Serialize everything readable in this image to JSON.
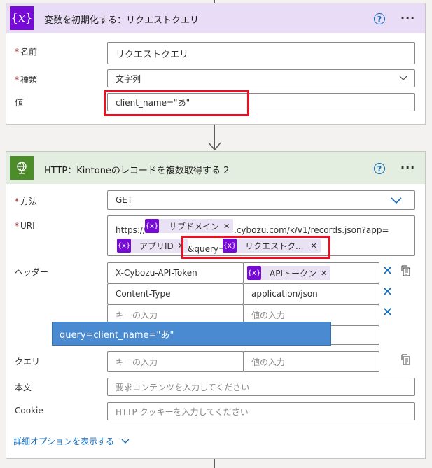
{
  "colors": {
    "var_header_bg": "#e8dcf6",
    "http_header_bg": "#e3eee0",
    "accent_purple": "#770bd6",
    "accent_green": "#4c8c2b",
    "link_blue": "#0f6cbd",
    "highlight_red": "#e81123",
    "tooltip_bg": "#4a8ad0"
  },
  "card1": {
    "title": "変数を初期化する：リクエストクエリ",
    "icon": "variable-icon",
    "icon_glyph": "{𝑥}",
    "help": "?",
    "menu": "···",
    "fields": {
      "name_label": "名前",
      "name_value": "リクエストクエリ",
      "type_label": "種類",
      "type_value": "文字列",
      "value_label": "値",
      "value_value": "client_name=\"あ\""
    }
  },
  "card2": {
    "title": "HTTP：Kintoneのレコードを複数取得する 2",
    "icon": "globe-icon",
    "help": "?",
    "menu": "···",
    "method_label": "方法",
    "method_value": "GET",
    "uri_label": "URI",
    "uri_text1": "https://",
    "uri_token1": "サブドメイン",
    "uri_text2": ".cybozu.com/k/v1/records.json?app=",
    "uri_token2": "アプリID",
    "uri_text3": "&query=",
    "uri_token3": "リクエストク...",
    "headers_label": "ヘッダー",
    "headers": [
      {
        "key": "X-Cybozu-API-Token",
        "value_token": "APIトークン"
      },
      {
        "key": "Content-Type",
        "value": "application/json"
      },
      {
        "key_placeholder": "キーの入力",
        "value_placeholder": "値の入力"
      }
    ],
    "tooltip": "query=client_name=\"あ\"",
    "query_label": "クエリ",
    "query_key_placeholder": "キーの入力",
    "query_value_placeholder": "値の入力",
    "body_label": "本文",
    "body_placeholder": "要求コンテンツを入力してください",
    "cookie_label": "Cookie",
    "cookie_placeholder": "HTTP クッキーを入力してください",
    "advanced_link": "詳細オプションを表示する"
  }
}
